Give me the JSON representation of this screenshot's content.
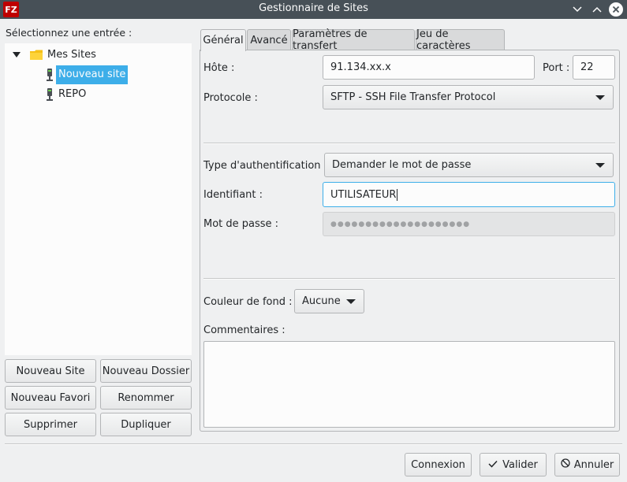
{
  "window": {
    "title": "Gestionnaire de Sites",
    "app_icon_text": "FZ"
  },
  "left": {
    "label": "Sélectionnez une entrée :",
    "tree": {
      "folder": "Mes Sites",
      "items": [
        {
          "label": "Nouveau site",
          "selected": true
        },
        {
          "label": "REPO",
          "selected": false
        }
      ]
    },
    "buttons": {
      "new_site": "Nouveau Site",
      "new_folder": "Nouveau Dossier",
      "new_bookmark": "Nouveau Favori",
      "rename": "Renommer",
      "delete": "Supprimer",
      "duplicate": "Dupliquer"
    }
  },
  "tabs": [
    "Général",
    "Avancé",
    "Paramètres de transfert",
    "Jeu de caractères"
  ],
  "general": {
    "host_label": "Hôte :",
    "host_value": "91.134.xx.x",
    "port_label": "Port :",
    "port_value": "22",
    "protocol_label": "Protocole :",
    "protocol_value": "SFTP - SSH File Transfer Protocol",
    "auth_label": "Type d'authentification :",
    "auth_value": "Demander le mot de passe",
    "user_label": "Identifiant :",
    "user_value": "UTILISATEUR",
    "password_label": "Mot de passe :",
    "password_value": "●●●●●●●●●●●●●●●●●●●●",
    "bgcolor_label": "Couleur de fond :",
    "bgcolor_value": "Aucune",
    "comments_label": "Commentaires :"
  },
  "footer": {
    "connect": "Connexion",
    "ok": "Valider",
    "cancel": "Annuler"
  },
  "colors": {
    "titlebar": "#475057",
    "selection": "#3daee9",
    "background": "#eff0f1"
  }
}
